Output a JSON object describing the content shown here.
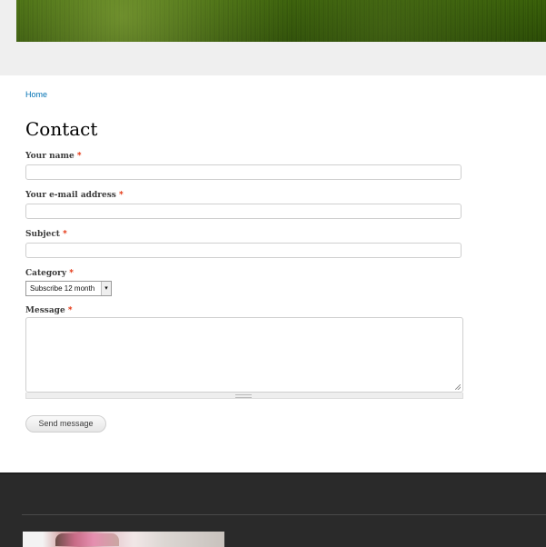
{
  "breadcrumb": {
    "home": "Home"
  },
  "page": {
    "title": "Contact"
  },
  "form": {
    "name_label": "Your name",
    "email_label": "Your e-mail address",
    "subject_label": "Subject",
    "category_label": "Category",
    "category_value": "Subscribe 12 month",
    "message_label": "Message",
    "required_mark": "*",
    "send_label": "Send message",
    "name_value": "",
    "email_value": "",
    "subject_value": "",
    "message_value": ""
  },
  "colors": {
    "link": "#0071b3",
    "required": "#e32700",
    "footer_bg": "#2a2a2a"
  }
}
